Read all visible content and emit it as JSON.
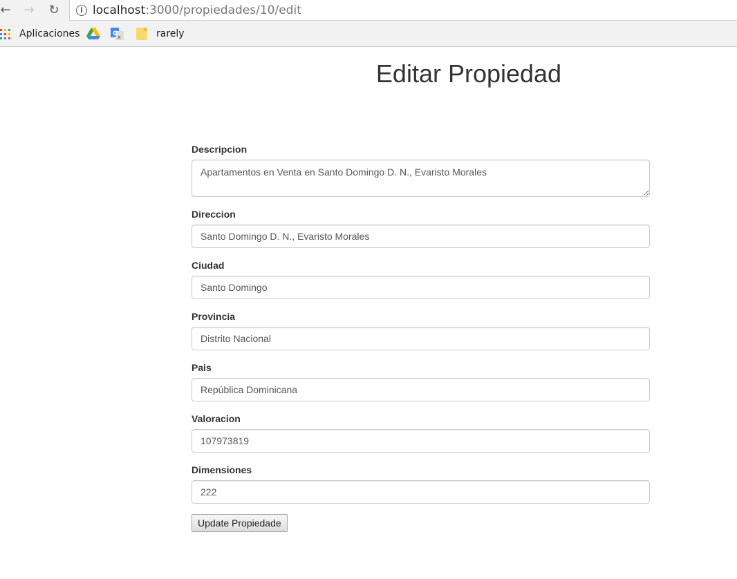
{
  "browser": {
    "url_host": "localhost",
    "url_path": ":3000/propiedades/10/edit",
    "info_symbol": "i"
  },
  "bookmarks": {
    "apps_label": "Aplicaciones",
    "folder_label": "rarely",
    "apps_colors": [
      "#ea4335",
      "#fbbc05",
      "#34a853",
      "#4285f4",
      "#ea4335",
      "#fbbc05",
      "#34a853",
      "#4285f4",
      "#ea4335"
    ]
  },
  "page": {
    "title": "Editar Propiedad"
  },
  "form": {
    "descripcion": {
      "label": "Descripcion",
      "value": "Apartamentos en Venta en Santo Domingo D. N., Evaristo Morales"
    },
    "direccion": {
      "label": "Direccion",
      "value": "Santo Domingo D. N., Evaristo Morales"
    },
    "ciudad": {
      "label": "Ciudad",
      "value": "Santo Domingo"
    },
    "provincia": {
      "label": "Provincia",
      "value": "Distrito Nacional"
    },
    "pais": {
      "label": "Pais",
      "value": "República Dominicana"
    },
    "valoracion": {
      "label": "Valoracion",
      "value": "107973819"
    },
    "dimensiones": {
      "label": "Dimensiones",
      "value": "222"
    },
    "submit_label": "Update Propiedade"
  }
}
